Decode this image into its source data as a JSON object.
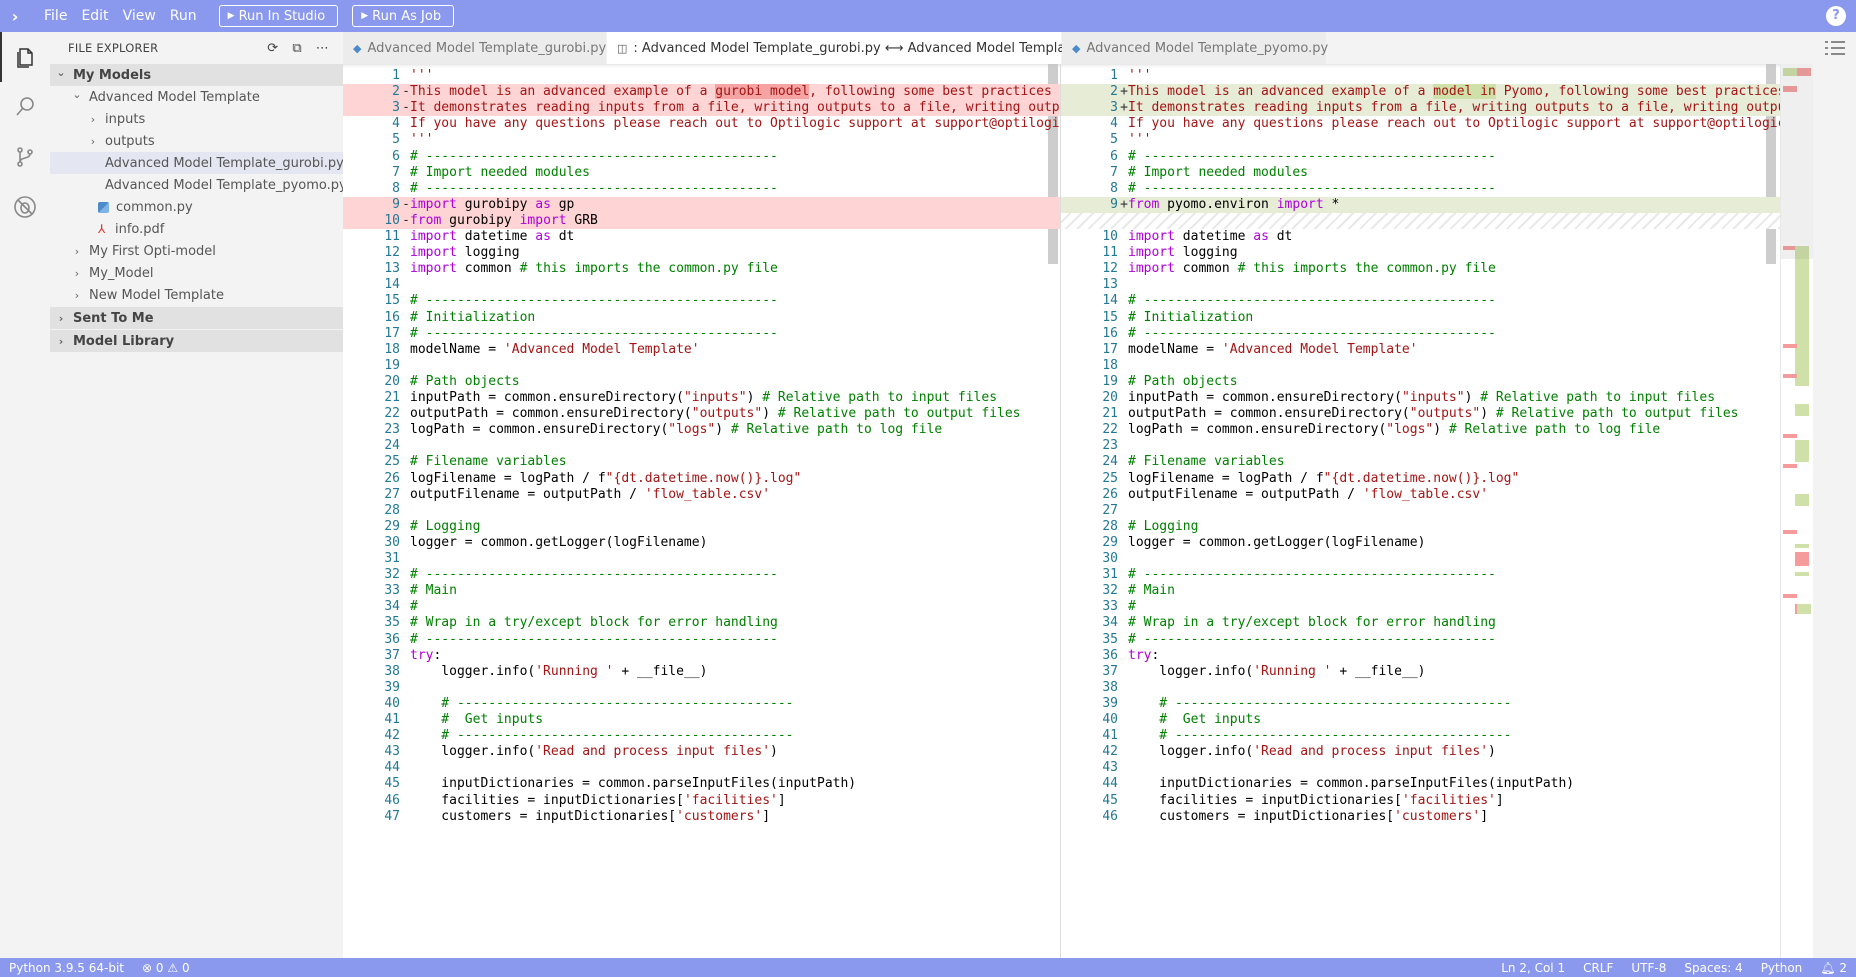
{
  "titlebar": {
    "menu": [
      "File",
      "Edit",
      "View",
      "Run"
    ],
    "run_in_studio": "Run In Studio",
    "run_as_job": "Run As Job",
    "help": "?"
  },
  "sidebar": {
    "title": "FILE EXPLORER",
    "tree": [
      {
        "label": "My Models",
        "level": 0,
        "type": "section",
        "expanded": true
      },
      {
        "label": "Advanced Model Template",
        "level": 1,
        "type": "folder",
        "expanded": true
      },
      {
        "label": "inputs",
        "level": 2,
        "type": "folder",
        "expanded": false
      },
      {
        "label": "outputs",
        "level": 2,
        "type": "folder",
        "expanded": false
      },
      {
        "label": "Advanced Model Template_gurobi.py",
        "level": 2,
        "type": "py",
        "selected": true
      },
      {
        "label": "Advanced Model Template_pyomo.py",
        "level": 2,
        "type": "py"
      },
      {
        "label": "common.py",
        "level": 2,
        "type": "py"
      },
      {
        "label": "info.pdf",
        "level": 2,
        "type": "pdf"
      },
      {
        "label": "My First Opti-model",
        "level": 1,
        "type": "folder",
        "expanded": false
      },
      {
        "label": "My_Model",
        "level": 1,
        "type": "folder",
        "expanded": false
      },
      {
        "label": "New Model Template",
        "level": 1,
        "type": "folder",
        "expanded": false
      },
      {
        "label": "Sent To Me",
        "level": 0,
        "type": "section",
        "expanded": false
      },
      {
        "label": "Model Library",
        "level": 0,
        "type": "section",
        "expanded": false
      }
    ]
  },
  "tabs": [
    {
      "label": "Advanced Model Template_gurobi.py",
      "active": false,
      "icon": "python-icon"
    },
    {
      "label": ": Advanced Model Template_gurobi.py ⟷ Advanced Model Template_pyomo.py",
      "active": true,
      "icon": "diff-icon"
    },
    {
      "label": "Advanced Model Template_pyomo.py",
      "active": false,
      "icon": "python-icon"
    }
  ],
  "left_lines": [
    {
      "n": "1",
      "t": "'''",
      "k": "doc"
    },
    {
      "n": "2",
      "t": "This model is an advanced example of a gurobi model, following some best practices fo",
      "k": "rem",
      "hl": "gurobi model"
    },
    {
      "n": "3",
      "t": "It demonstrates reading inputs from a file, writing outputs to a file, writing outpu",
      "k": "rem"
    },
    {
      "n": "4",
      "t": "If you have any questions please reach out to Optilogic support at support@optilogic.",
      "k": "doc"
    },
    {
      "n": "5",
      "t": "'''",
      "k": "doc"
    },
    {
      "n": "6",
      "t": "# ---------------------------------------------",
      "k": "com"
    },
    {
      "n": "7",
      "t": "# Import needed modules",
      "k": "com"
    },
    {
      "n": "8",
      "t": "# ---------------------------------------------",
      "k": "com"
    },
    {
      "n": "9",
      "t": "import gurobipy as gp",
      "k": "rem",
      "hl": "gurobipy as gp"
    },
    {
      "n": "10",
      "t": "from gurobipy import GRB",
      "k": "rem",
      "hl": "gurobipy import GRB"
    },
    {
      "n": "11",
      "t": "import datetime as dt",
      "k": "code"
    },
    {
      "n": "12",
      "t": "import logging",
      "k": "code"
    },
    {
      "n": "13",
      "t": "import common # this imports the common.py file",
      "k": "code"
    },
    {
      "n": "14",
      "t": "",
      "k": "code"
    },
    {
      "n": "15",
      "t": "# ---------------------------------------------",
      "k": "com"
    },
    {
      "n": "16",
      "t": "# Initialization",
      "k": "com"
    },
    {
      "n": "17",
      "t": "# ---------------------------------------------",
      "k": "com"
    },
    {
      "n": "18",
      "t": "modelName = 'Advanced Model Template'",
      "k": "code"
    },
    {
      "n": "19",
      "t": "",
      "k": "code"
    },
    {
      "n": "20",
      "t": "# Path objects",
      "k": "com"
    },
    {
      "n": "21",
      "t": "inputPath = common.ensureDirectory(\"inputs\") # Relative path to input files",
      "k": "code"
    },
    {
      "n": "22",
      "t": "outputPath = common.ensureDirectory(\"outputs\") # Relative path to output files",
      "k": "code"
    },
    {
      "n": "23",
      "t": "logPath = common.ensureDirectory(\"logs\") # Relative path to log file",
      "k": "code"
    },
    {
      "n": "24",
      "t": "",
      "k": "code"
    },
    {
      "n": "25",
      "t": "# Filename variables",
      "k": "com"
    },
    {
      "n": "26",
      "t": "logFilename = logPath / f\"{dt.datetime.now()}.log\"",
      "k": "code"
    },
    {
      "n": "27",
      "t": "outputFilename = outputPath / 'flow_table.csv'",
      "k": "code"
    },
    {
      "n": "28",
      "t": "",
      "k": "code"
    },
    {
      "n": "29",
      "t": "# Logging",
      "k": "com"
    },
    {
      "n": "30",
      "t": "logger = common.getLogger(logFilename)",
      "k": "code"
    },
    {
      "n": "31",
      "t": "",
      "k": "code"
    },
    {
      "n": "32",
      "t": "# ---------------------------------------------",
      "k": "com"
    },
    {
      "n": "33",
      "t": "# Main",
      "k": "com"
    },
    {
      "n": "34",
      "t": "#",
      "k": "com"
    },
    {
      "n": "35",
      "t": "# Wrap in a try/except block for error handling",
      "k": "com"
    },
    {
      "n": "36",
      "t": "# ---------------------------------------------",
      "k": "com"
    },
    {
      "n": "37",
      "t": "try:",
      "k": "code"
    },
    {
      "n": "38",
      "t": "    logger.info('Running ' + __file__)",
      "k": "code"
    },
    {
      "n": "39",
      "t": "",
      "k": "code"
    },
    {
      "n": "40",
      "t": "    # -------------------------------------------",
      "k": "com"
    },
    {
      "n": "41",
      "t": "    #  Get inputs",
      "k": "com"
    },
    {
      "n": "42",
      "t": "    # -------------------------------------------",
      "k": "com"
    },
    {
      "n": "43",
      "t": "    logger.info('Read and process input files')",
      "k": "code"
    },
    {
      "n": "44",
      "t": "",
      "k": "code"
    },
    {
      "n": "45",
      "t": "    inputDictionaries = common.parseInputFiles(inputPath)",
      "k": "code"
    },
    {
      "n": "46",
      "t": "    facilities = inputDictionaries['facilities']",
      "k": "code"
    },
    {
      "n": "47",
      "t": "    customers = inputDictionaries['customers']",
      "k": "code"
    }
  ],
  "right_lines": [
    {
      "n": "1",
      "t": "'''",
      "k": "doc"
    },
    {
      "n": "2",
      "t": "This model is an advanced example of a model in Pyomo, following some best practices",
      "k": "add",
      "hl": "model in"
    },
    {
      "n": "3",
      "t": "It demonstrates reading inputs from a file, writing outputs to a file, writing output",
      "k": "add"
    },
    {
      "n": "4",
      "t": "If you have any questions please reach out to Optilogic support at support@optilogic.",
      "k": "doc"
    },
    {
      "n": "5",
      "t": "'''",
      "k": "doc"
    },
    {
      "n": "6",
      "t": "# ---------------------------------------------",
      "k": "com"
    },
    {
      "n": "7",
      "t": "# Import needed modules",
      "k": "com"
    },
    {
      "n": "8",
      "t": "# ---------------------------------------------",
      "k": "com"
    },
    {
      "n": "9",
      "t": "from pyomo.environ import *",
      "k": "add",
      "hl": "pyomo.environ import *"
    },
    {
      "n": "",
      "t": "",
      "k": "filler"
    },
    {
      "n": "10",
      "t": "import datetime as dt",
      "k": "code"
    },
    {
      "n": "11",
      "t": "import logging",
      "k": "code"
    },
    {
      "n": "12",
      "t": "import common # this imports the common.py file",
      "k": "code"
    },
    {
      "n": "13",
      "t": "",
      "k": "code"
    },
    {
      "n": "14",
      "t": "# ---------------------------------------------",
      "k": "com"
    },
    {
      "n": "15",
      "t": "# Initialization",
      "k": "com"
    },
    {
      "n": "16",
      "t": "# ---------------------------------------------",
      "k": "com"
    },
    {
      "n": "17",
      "t": "modelName = 'Advanced Model Template'",
      "k": "code"
    },
    {
      "n": "18",
      "t": "",
      "k": "code"
    },
    {
      "n": "19",
      "t": "# Path objects",
      "k": "com"
    },
    {
      "n": "20",
      "t": "inputPath = common.ensureDirectory(\"inputs\") # Relative path to input files",
      "k": "code"
    },
    {
      "n": "21",
      "t": "outputPath = common.ensureDirectory(\"outputs\") # Relative path to output files",
      "k": "code"
    },
    {
      "n": "22",
      "t": "logPath = common.ensureDirectory(\"logs\") # Relative path to log file",
      "k": "code"
    },
    {
      "n": "23",
      "t": "",
      "k": "code"
    },
    {
      "n": "24",
      "t": "# Filename variables",
      "k": "com"
    },
    {
      "n": "25",
      "t": "logFilename = logPath / f\"{dt.datetime.now()}.log\"",
      "k": "code"
    },
    {
      "n": "26",
      "t": "outputFilename = outputPath / 'flow_table.csv'",
      "k": "code"
    },
    {
      "n": "27",
      "t": "",
      "k": "code"
    },
    {
      "n": "28",
      "t": "# Logging",
      "k": "com"
    },
    {
      "n": "29",
      "t": "logger = common.getLogger(logFilename)",
      "k": "code"
    },
    {
      "n": "30",
      "t": "",
      "k": "code"
    },
    {
      "n": "31",
      "t": "# ---------------------------------------------",
      "k": "com"
    },
    {
      "n": "32",
      "t": "# Main",
      "k": "com"
    },
    {
      "n": "33",
      "t": "#",
      "k": "com"
    },
    {
      "n": "34",
      "t": "# Wrap in a try/except block for error handling",
      "k": "com"
    },
    {
      "n": "35",
      "t": "# ---------------------------------------------",
      "k": "com"
    },
    {
      "n": "36",
      "t": "try:",
      "k": "code"
    },
    {
      "n": "37",
      "t": "    logger.info('Running ' + __file__)",
      "k": "code"
    },
    {
      "n": "38",
      "t": "",
      "k": "code"
    },
    {
      "n": "39",
      "t": "    # -------------------------------------------",
      "k": "com"
    },
    {
      "n": "40",
      "t": "    #  Get inputs",
      "k": "com"
    },
    {
      "n": "41",
      "t": "    # -------------------------------------------",
      "k": "com"
    },
    {
      "n": "42",
      "t": "    logger.info('Read and process input files')",
      "k": "code"
    },
    {
      "n": "43",
      "t": "",
      "k": "code"
    },
    {
      "n": "44",
      "t": "    inputDictionaries = common.parseInputFiles(inputPath)",
      "k": "code"
    },
    {
      "n": "45",
      "t": "    facilities = inputDictionaries['facilities']",
      "k": "code"
    },
    {
      "n": "46",
      "t": "    customers = inputDictionaries['customers']",
      "k": "code"
    }
  ],
  "statusbar": {
    "interpreter": "Python 3.9.5 64-bit",
    "errors": "0",
    "warnings": "0",
    "position": "Ln 2, Col 1",
    "eol": "CRLF",
    "encoding": "UTF-8",
    "indent": "Spaces: 4",
    "language": "Python",
    "notifications": "2"
  },
  "colors": {
    "accent": "#8a98ee",
    "removed_line": "#ffd4d4",
    "added_line": "#e6ecd6"
  }
}
